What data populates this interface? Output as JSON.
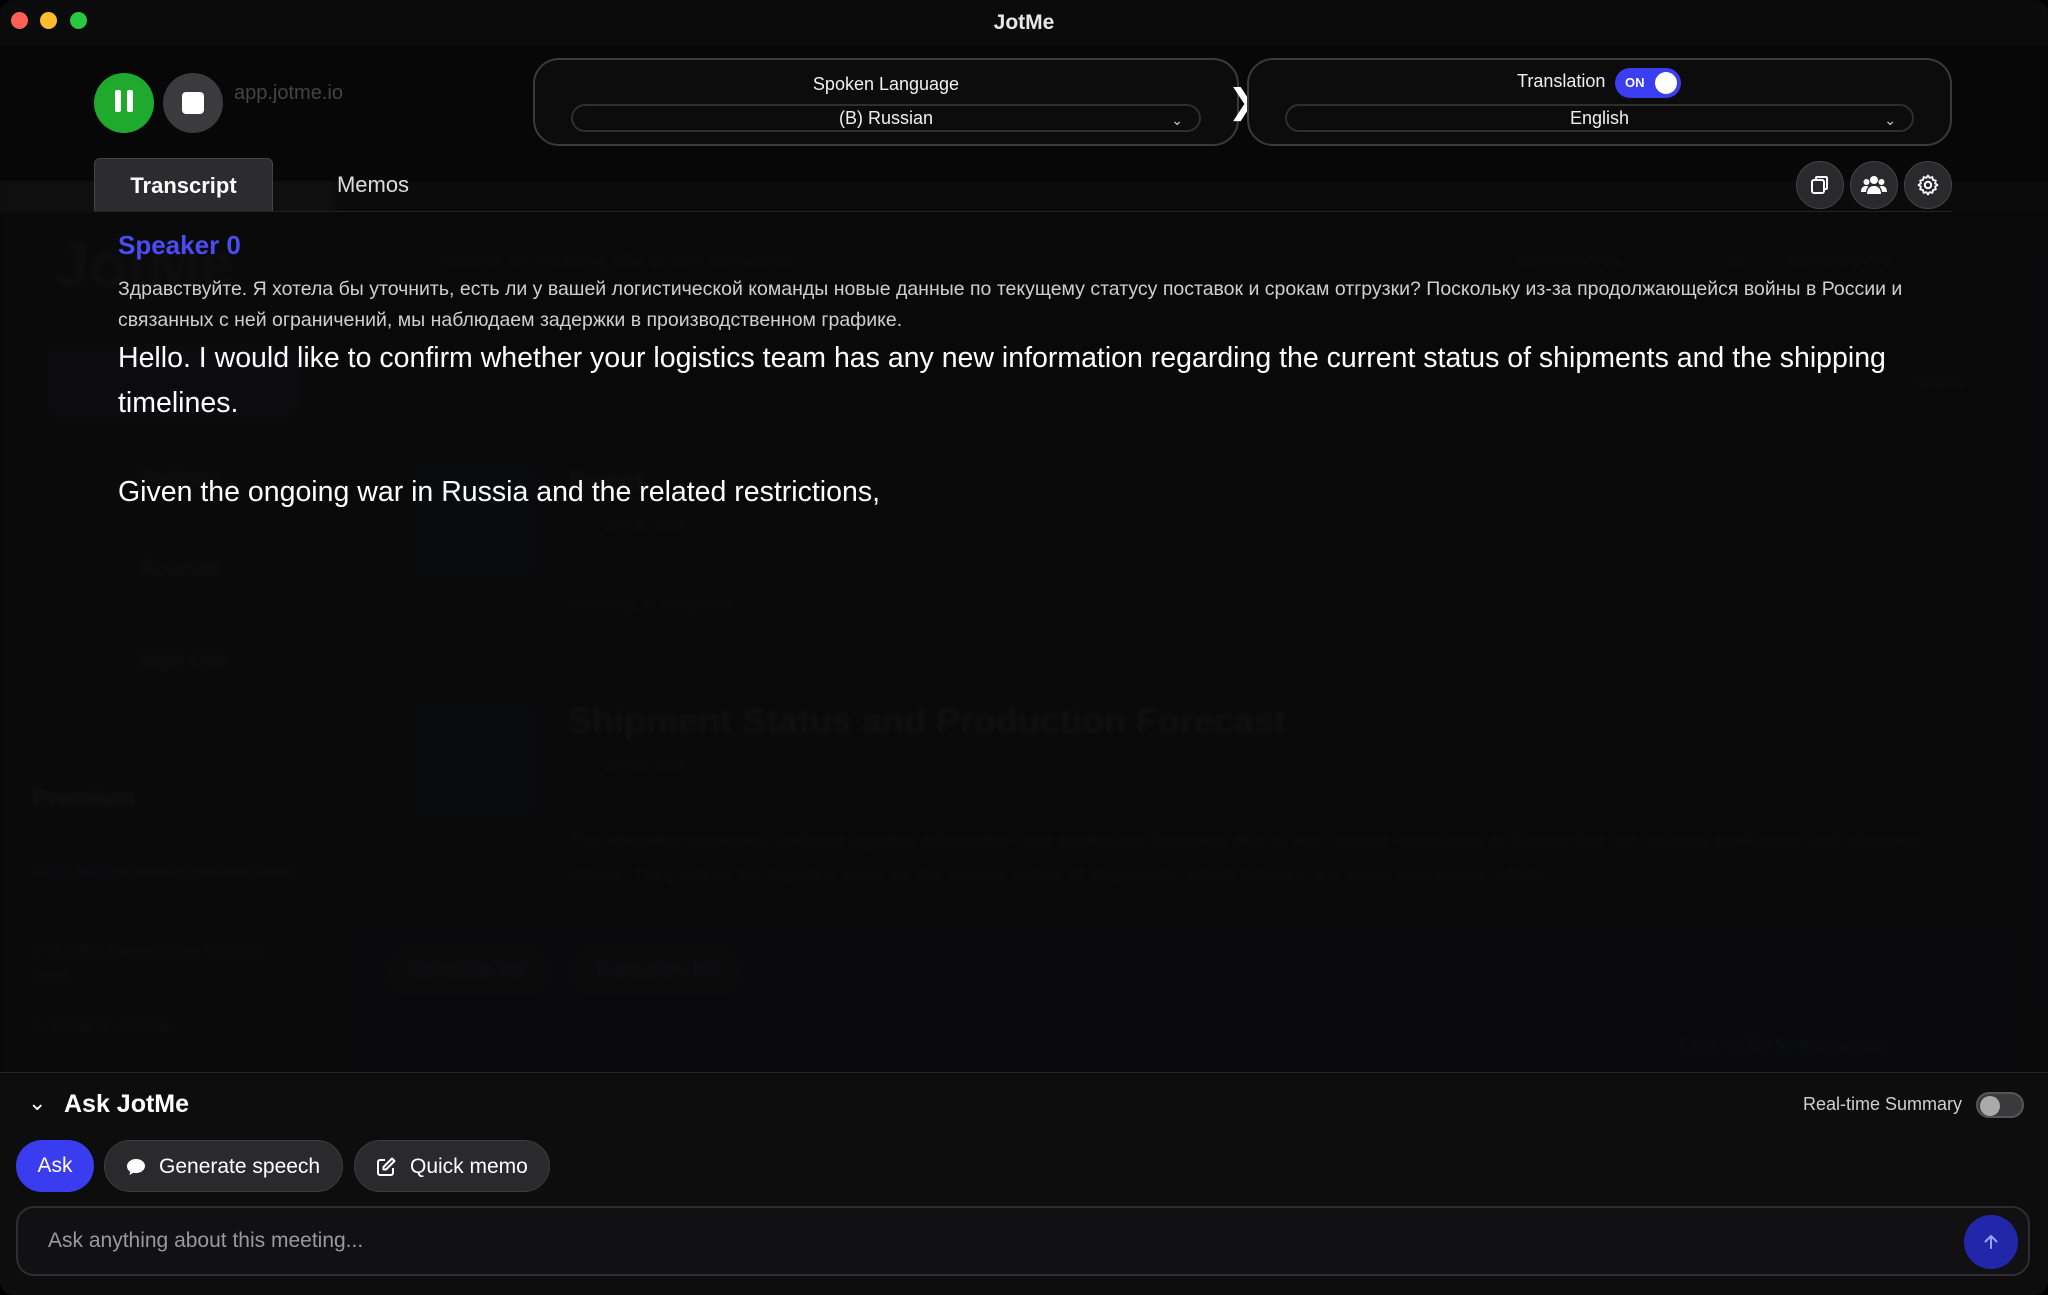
{
  "window": {
    "title": "JotMe"
  },
  "recorder": {
    "faint_url": "app.jotme.io"
  },
  "spoken_language": {
    "label": "Spoken Language",
    "value": "(B) Russian"
  },
  "translation": {
    "label": "Translation",
    "toggle_text": "ON",
    "enabled": true,
    "value": "English"
  },
  "tabs": [
    {
      "label": "Transcript",
      "active": true
    },
    {
      "label": "Memos",
      "active": false
    }
  ],
  "transcript": {
    "speaker": "Speaker 0",
    "original": "Здравствуйте. Я хотела бы уточнить, есть ли у вашей логистической команды новые данные по текущему статусу поставок и срокам отгрузки? Поскольку из-за продолжающейся войны в России и связанных с ней ограничений, мы наблюдаем задержки в производственном графике.",
    "translation_1": "Hello. I would like to confirm whether your logistics team has any new information regarding the current status of shipments and the shipping timelines.",
    "translation_2": "Given the ongoing war in Russia and the related restrictions,"
  },
  "background": {
    "logo": "JotMe",
    "nav": [
      "Settings",
      "Account",
      "Sign Out"
    ],
    "premium": "Premium",
    "usage": [
      "60 of 500 translation minutes used",
      "1 of 2000 transcription minutes used",
      "3 of 100 AI Credits"
    ],
    "search_placeholder": "Search by meeting title or any keywords",
    "date_placeholder": "dd/mm/yyyy",
    "date_sep": "to",
    "select": "Select",
    "cards": [
      {
        "month": "MAY",
        "day": "19",
        "title": "Event",
        "time": "10:06 AM",
        "text": "Meeting in progress"
      },
      {
        "month": "MAY",
        "day": "19",
        "title": "Shipment Status and Production Forecast",
        "time": "10:04 AM",
        "text": "The attendee requested updated logistics information and production forecasts due to war-related restrictions in Russia that are causing production and shipment delays. They asked the logistics team for the current status of shipments, which batches are being processed, which..."
      }
    ],
    "buttons": [
      "Schedule bot",
      "Transcribe file"
    ],
    "upload": "Drop a file to transcribe"
  },
  "ask_panel": {
    "title": "Ask JotMe",
    "realtime_summary_label": "Real-time Summary",
    "realtime_summary_enabled": false,
    "buttons": {
      "ask": "Ask",
      "generate_speech": "Generate speech",
      "quick_memo": "Quick memo"
    },
    "input_placeholder": "Ask anything about this meeting..."
  }
}
